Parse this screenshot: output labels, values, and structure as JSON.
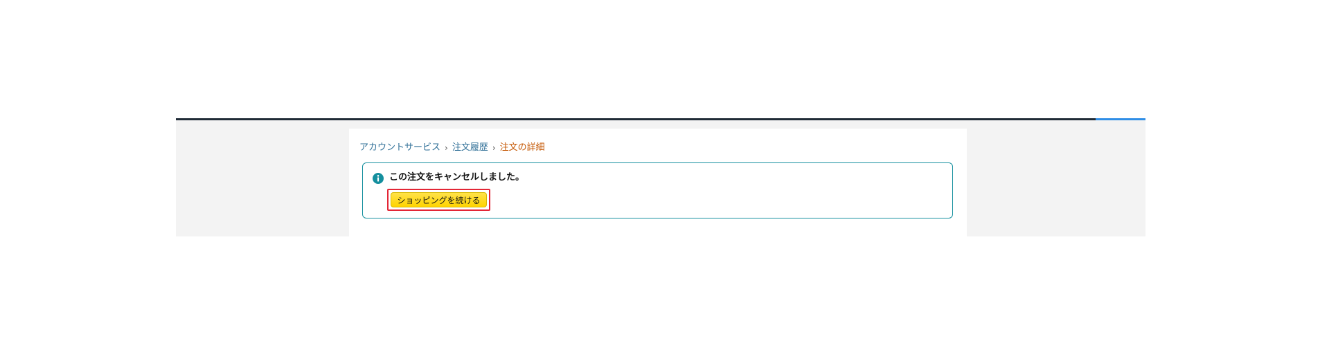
{
  "breadcrumb": {
    "items": [
      {
        "label": "アカウントサービス"
      },
      {
        "label": "注文履歴"
      },
      {
        "label": "注文の詳細"
      }
    ],
    "separator": "›"
  },
  "alert": {
    "icon": "info-icon",
    "message": "この注文をキャンセルしました。",
    "button_label": "ショッピングを続ける"
  },
  "colors": {
    "link": "#2f6f97",
    "current_crumb": "#c45500",
    "alert_border": "#148f9e",
    "button_bg": "#ffd814",
    "highlight_outline": "#e32636"
  }
}
